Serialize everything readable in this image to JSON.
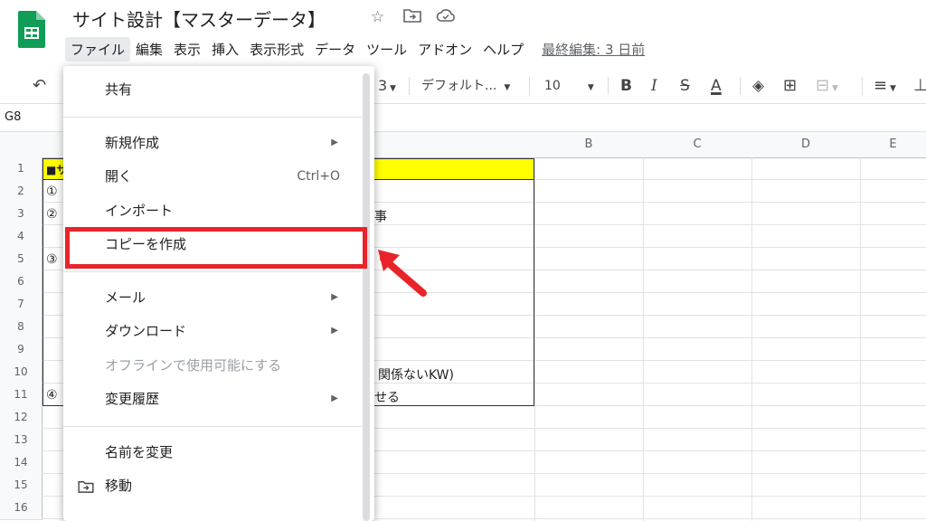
{
  "app": {
    "title": "サイト設計【マスターデータ】",
    "last_edit": "最終編集: 3 日前"
  },
  "menubar": [
    {
      "label": "ファイル",
      "active": true
    },
    {
      "label": "編集"
    },
    {
      "label": "表示"
    },
    {
      "label": "挿入"
    },
    {
      "label": "表示形式"
    },
    {
      "label": "データ"
    },
    {
      "label": "ツール"
    },
    {
      "label": "アドオン"
    },
    {
      "label": "ヘルプ"
    }
  ],
  "toolbar": {
    "zoom_tail": "3",
    "font": "デフォルト...",
    "font_size": "10",
    "bold": "B",
    "italic": "I",
    "strike": "S",
    "text_color": "A"
  },
  "name_box": "G8",
  "columns": [
    "B",
    "C",
    "D",
    "E"
  ],
  "rows": [
    "1",
    "2",
    "3",
    "4",
    "5",
    "6",
    "7",
    "8",
    "9",
    "10",
    "11",
    "12",
    "13",
    "14",
    "15",
    "16"
  ],
  "cells": {
    "a1_fragment": "■サ",
    "a2": "①",
    "a3": "②",
    "a5": "③",
    "a11": "④",
    "r3_tail": "事",
    "r10_tail": "関係ないKW)",
    "r11_tail": "せる"
  },
  "colors": {
    "accent_red": "#e8242a",
    "header_yellow": "#ffff00",
    "sheets_green": "#0f9d58"
  },
  "file_menu": {
    "items": [
      {
        "label": "共有"
      },
      {
        "sep": true
      },
      {
        "label": "新規作成",
        "submenu": true
      },
      {
        "label": "開く",
        "shortcut": "Ctrl+O"
      },
      {
        "label": "インポート"
      },
      {
        "label": "コピーを作成",
        "highlighted": true
      },
      {
        "sep": true
      },
      {
        "label": "メール",
        "submenu": true
      },
      {
        "label": "ダウンロード",
        "submenu": true
      },
      {
        "label": "オフラインで使用可能にする",
        "disabled": true
      },
      {
        "label": "変更履歴",
        "submenu": true
      },
      {
        "sep": true
      },
      {
        "label": "名前を変更"
      },
      {
        "label": "移動",
        "icon": "folder-move-icon"
      }
    ]
  }
}
